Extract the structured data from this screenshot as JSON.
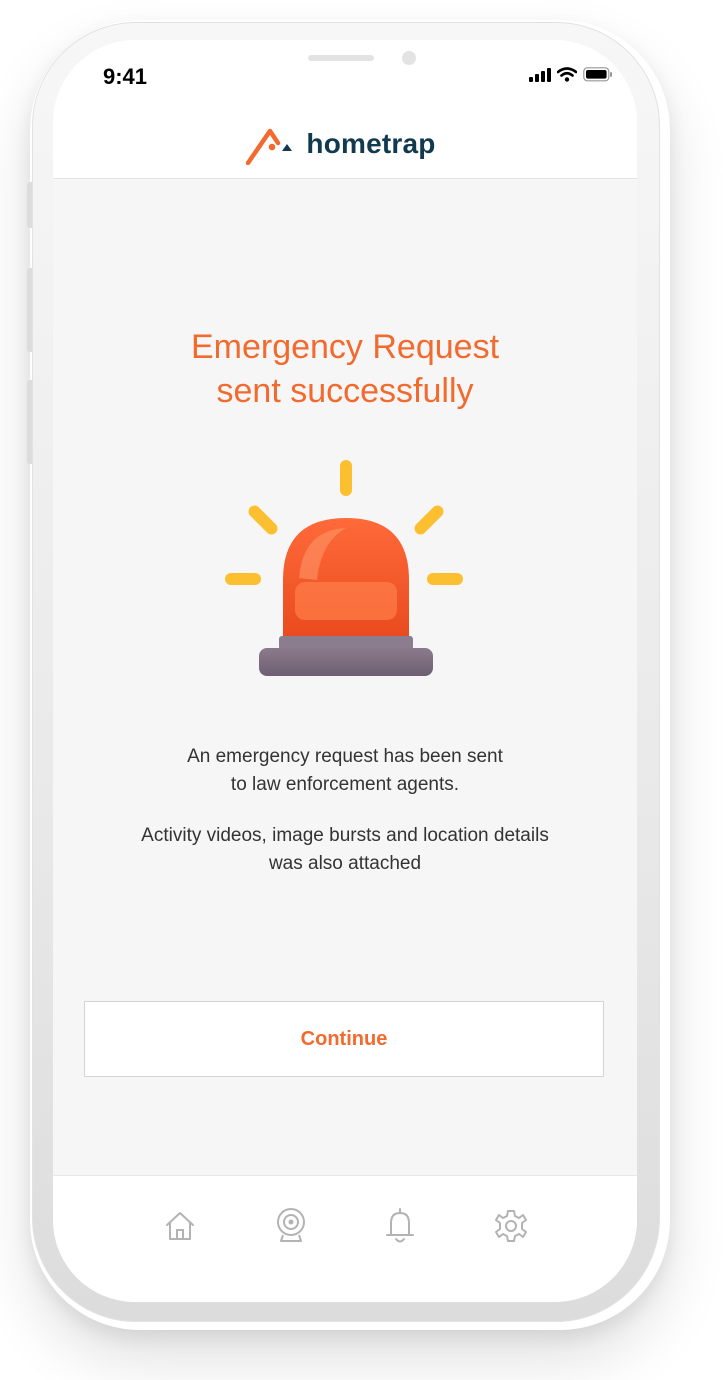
{
  "status_bar": {
    "time": "9:41"
  },
  "header": {
    "brand": "hometrap",
    "brand_color": "#123a4f",
    "accent": "#f26a2e"
  },
  "main": {
    "title_line1": "Emergency Request",
    "title_line2": "sent successfully",
    "message1_line1": "An emergency request has been sent",
    "message1_line2": "to law enforcement agents.",
    "message2_line1": "Activity videos, image bursts and location details",
    "message2_line2": "was also attached",
    "illustration": "siren-icon"
  },
  "actions": {
    "continue_label": "Continue"
  },
  "tabbar": {
    "items": [
      {
        "icon": "home-icon"
      },
      {
        "icon": "camera-icon"
      },
      {
        "icon": "bell-icon"
      },
      {
        "icon": "gear-icon"
      }
    ]
  }
}
